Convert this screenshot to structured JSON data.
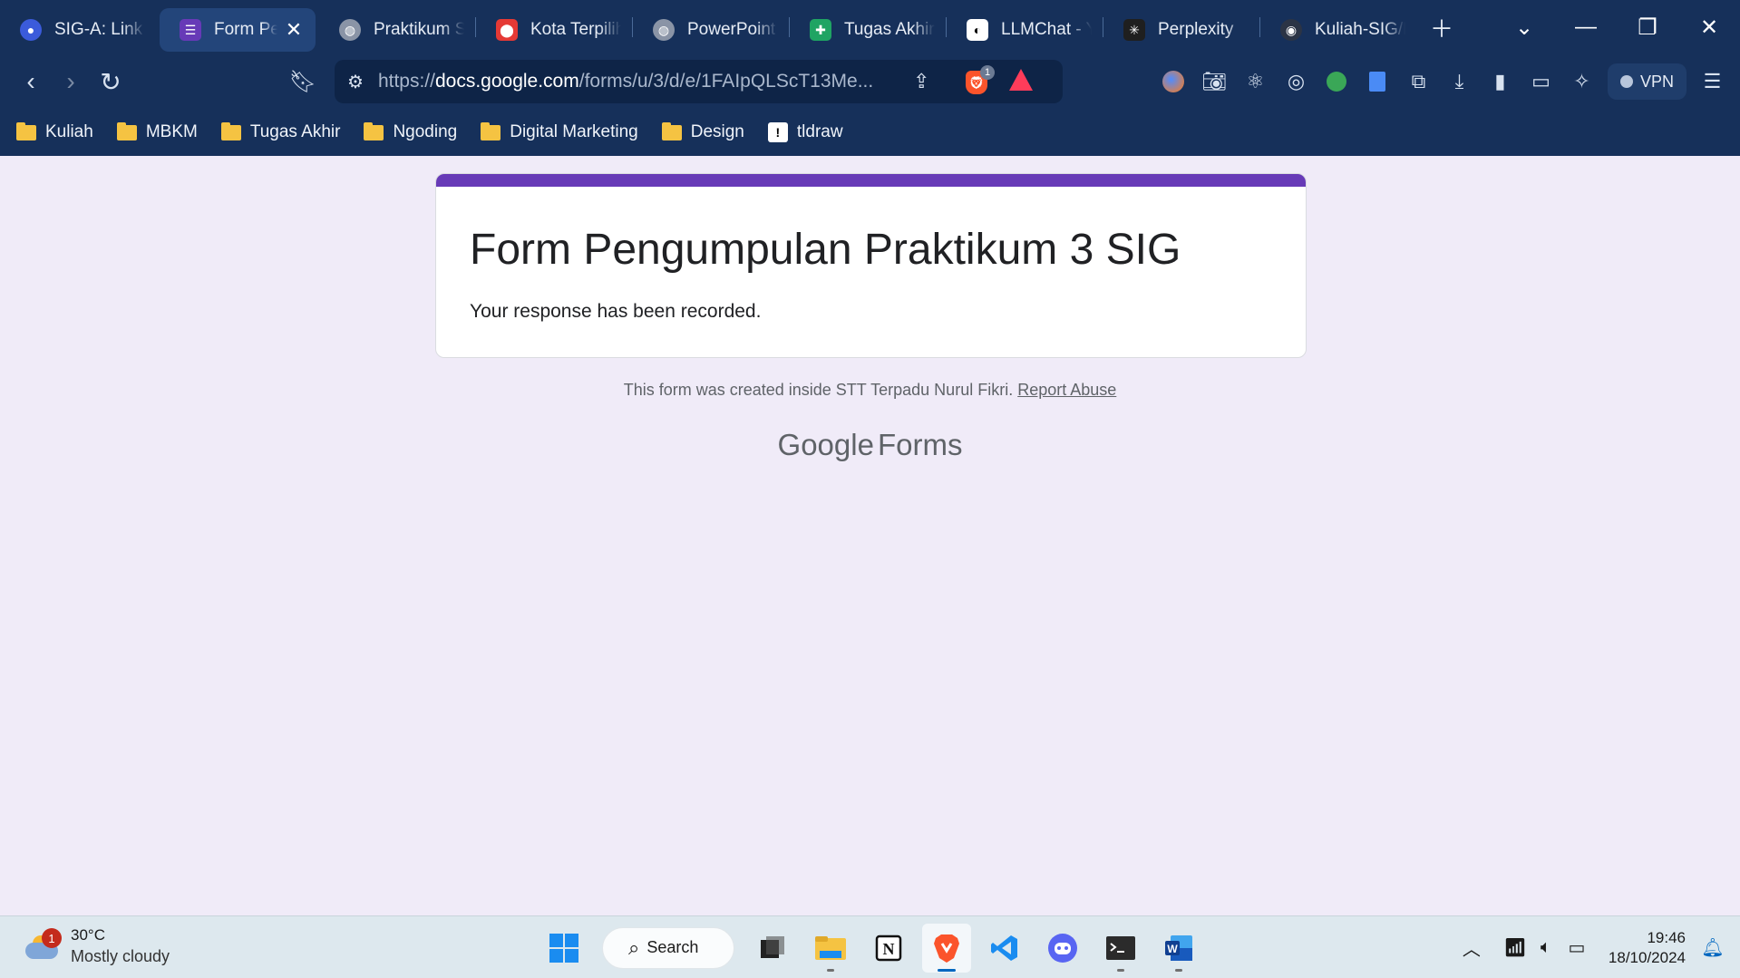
{
  "tabs": [
    {
      "title": "SIG-A: Link P",
      "icon": "orbit-icon",
      "color": "#3b5bdb"
    },
    {
      "title": "Form Pe",
      "icon": "google-forms-icon",
      "color": "#673ab7",
      "active": true
    },
    {
      "title": "Praktikum SI",
      "icon": "globe-icon",
      "color": "#8a94a6"
    },
    {
      "title": "Kota Terpilih",
      "icon": "map-pin-icon",
      "color": "#e53935"
    },
    {
      "title": "PowerPoint I",
      "icon": "globe-icon",
      "color": "#8a94a6"
    },
    {
      "title": "Tugas Akhir",
      "icon": "google-sheets-icon",
      "color": "#1fa463"
    },
    {
      "title": "LLMChat - Y",
      "icon": "llmchat-icon",
      "color": "#ffffff"
    },
    {
      "title": "Perplexity",
      "icon": "perplexity-icon",
      "color": "#1f1f1f"
    },
    {
      "title": "Kuliah-SIG/P",
      "icon": "github-icon",
      "color": "#2b3445"
    }
  ],
  "toolbar": {
    "url_prefix": "https://",
    "url_domain": "docs.google.com",
    "url_path": "/forms/u/3/d/e/1FAIpQLScT13Me...",
    "brave_badge": "1",
    "vpn_label": "VPN"
  },
  "bookmarks": [
    {
      "label": "Kuliah",
      "type": "folder"
    },
    {
      "label": "MBKM",
      "type": "folder"
    },
    {
      "label": "Tugas Akhir",
      "type": "folder"
    },
    {
      "label": "Ngoding",
      "type": "folder"
    },
    {
      "label": "Digital Marketing",
      "type": "folder"
    },
    {
      "label": "Design",
      "type": "folder"
    },
    {
      "label": "tldraw",
      "type": "site"
    }
  ],
  "form": {
    "title": "Form Pengumpulan Praktikum 3 SIG",
    "message": "Your response has been recorded.",
    "footer_text": "This form was created inside STT Terpadu Nurul Fikri.",
    "report_link": "Report Abuse",
    "brand_google": "Google",
    "brand_forms": "Forms",
    "accent_color": "#673ab7"
  },
  "taskbar": {
    "weather_temp": "30°C",
    "weather_desc": "Mostly cloudy",
    "weather_badge": "1",
    "search_label": "Search",
    "time": "19:46",
    "date": "18/10/2024"
  }
}
